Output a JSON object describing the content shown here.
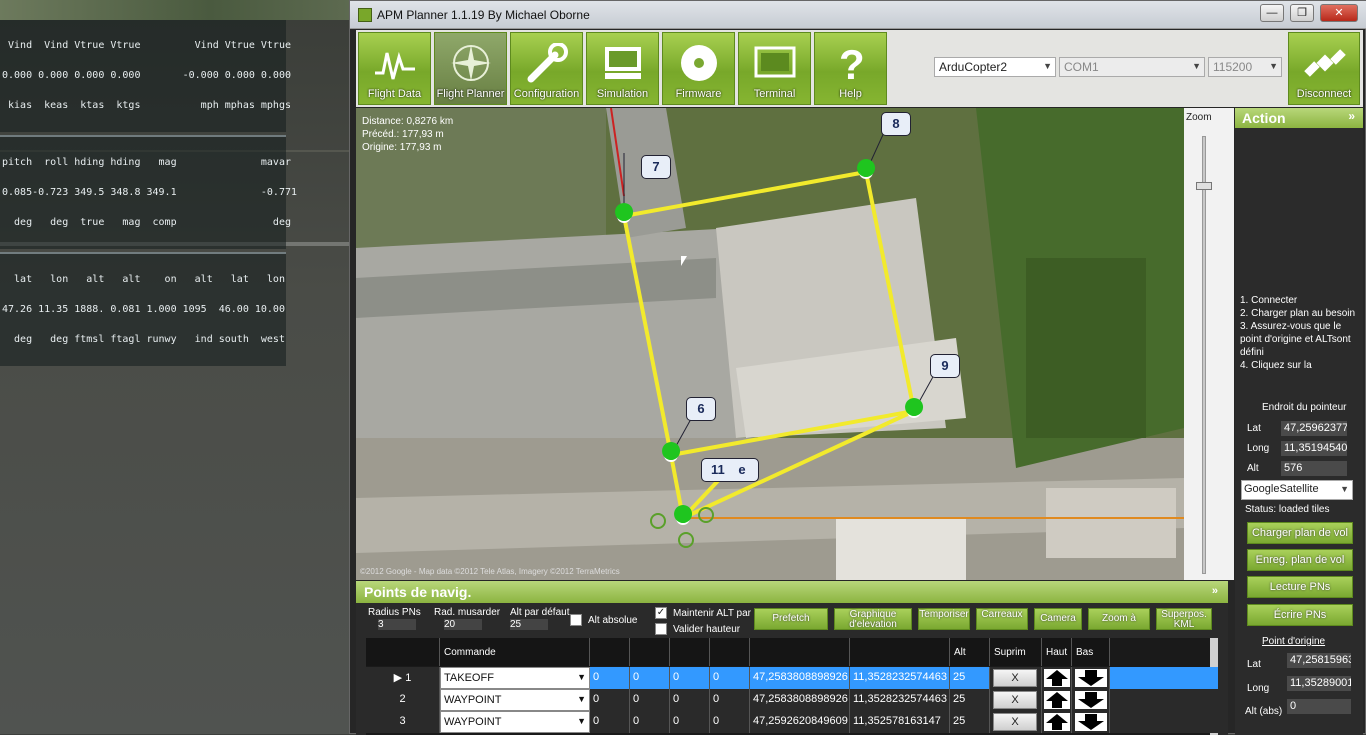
{
  "hud": {
    "block1": [
      " Vind  Vind Vtrue Vtrue         Vind Vtrue Vtrue",
      "0.000 0.000 0.000 0.000       -0.000 0.000 0.000",
      " kias  keas  ktas  ktgs          mph mphas mphgs"
    ],
    "block2": [
      "pitch  roll hding hding   mag              mavar",
      "0.085-0.723 349.5 348.8 349.1              -0.771",
      "  deg   deg  true   mag  comp                deg"
    ],
    "block3": [
      "  lat   lon   alt   alt    on   alt   lat   lon",
      "47.26 11.35 1888. 0.081 1.000 1095  46.00 10.00",
      "  deg   deg ftmsl ftagl runwy   ind south  west"
    ]
  },
  "window": {
    "title": "APM Planner 1.1.19  By Michael Oborne",
    "minimize": "—",
    "maximize": "❐",
    "close": "✕"
  },
  "toolbar": {
    "buttons": [
      {
        "label": "Flight Data",
        "icon": "pulse-icon"
      },
      {
        "label": "Flight Planner",
        "icon": "compass-icon"
      },
      {
        "label": "Configuration",
        "icon": "wrench-icon"
      },
      {
        "label": "Simulation",
        "icon": "monitor-icon"
      },
      {
        "label": "Firmware",
        "icon": "disc-icon"
      },
      {
        "label": "Terminal",
        "icon": "terminal-icon"
      },
      {
        "label": "Help",
        "icon": "help-icon"
      }
    ],
    "vehicle": "ArduCopter2",
    "port": "COM1",
    "baud": "115200",
    "connect_label": "Disconnect"
  },
  "map": {
    "info": [
      "Distance: 0,8276 km",
      "Précéd.: 177,93 m",
      "Origine: 177,93 m"
    ],
    "markers": [
      "7",
      "8",
      "9",
      "6",
      "11"
    ],
    "marker_extra": "e",
    "copyright": "©2012 Google - Map data ©2012 Tele Atlas, Imagery ©2012 TerraMetrics"
  },
  "zoom": {
    "label": "Zoom"
  },
  "action": {
    "title": "Action",
    "collapse": "»",
    "instructions": [
      "1. Connecter",
      "2. Charger plan au besoin",
      "3. Assurez-vous que le point d'origine et ALTsont défini",
      "4. Cliquez sur la"
    ],
    "pointer_title": "Endroit du pointeur",
    "lat_label": "Lat",
    "lat": "47,25962377",
    "long_label": "Long",
    "long": "11,35194540",
    "alt_label": "Alt",
    "alt": "576",
    "map_type": "GoogleSatellite",
    "status": "Status: loaded tiles",
    "buttons": [
      "Charger plan de vol",
      "Enreg. plan de vol",
      "Lecture PNs",
      "Écrire PNs"
    ],
    "home_title": "Point d'origine",
    "home_lat_label": "Lat",
    "home_lat": "47,25815963",
    "home_long_label": "Long",
    "home_long": "11,35289001",
    "home_alt_label": "Alt (abs)",
    "home_alt": "0"
  },
  "waypoints": {
    "title": "Points de navig.",
    "collapse": "»",
    "radius_label": "Radius PNs",
    "radius": "3",
    "loiter_label": "Rad. musarder",
    "loiter": "20",
    "alt_default_label": "Alt par défaut",
    "alt_default": "25",
    "abs_alt_label": "Alt absolue",
    "hold_alt_label": "Maintenir ALT par défaut",
    "verify_label": "Valider hauteur",
    "buttons": [
      "Prefetch",
      "Graphique d'elevation",
      "Temporiser",
      "Carreaux",
      "Camera",
      "Zoom à",
      "Superpos. KML"
    ],
    "headers": [
      "",
      "Commande",
      "",
      "",
      "",
      "",
      "",
      "",
      "Alt",
      "Suprim",
      "Haut",
      "Bas"
    ],
    "rows": [
      {
        "n": "1",
        "cmd": "TAKEOFF",
        "p1": "0",
        "p2": "0",
        "p3": "0",
        "p4": "0",
        "lat": "47,2583808898926",
        "lon": "11,3528232574463",
        "alt": "25",
        "del": "X"
      },
      {
        "n": "2",
        "cmd": "WAYPOINT",
        "p1": "0",
        "p2": "0",
        "p3": "0",
        "p4": "0",
        "lat": "47,2583808898926",
        "lon": "11,3528232574463",
        "alt": "25",
        "del": "X"
      },
      {
        "n": "3",
        "cmd": "WAYPOINT",
        "p1": "0",
        "p2": "0",
        "p3": "0",
        "p4": "0",
        "lat": "47,2592620849609",
        "lon": "11,352578163147",
        "alt": "25",
        "del": "X"
      }
    ]
  }
}
